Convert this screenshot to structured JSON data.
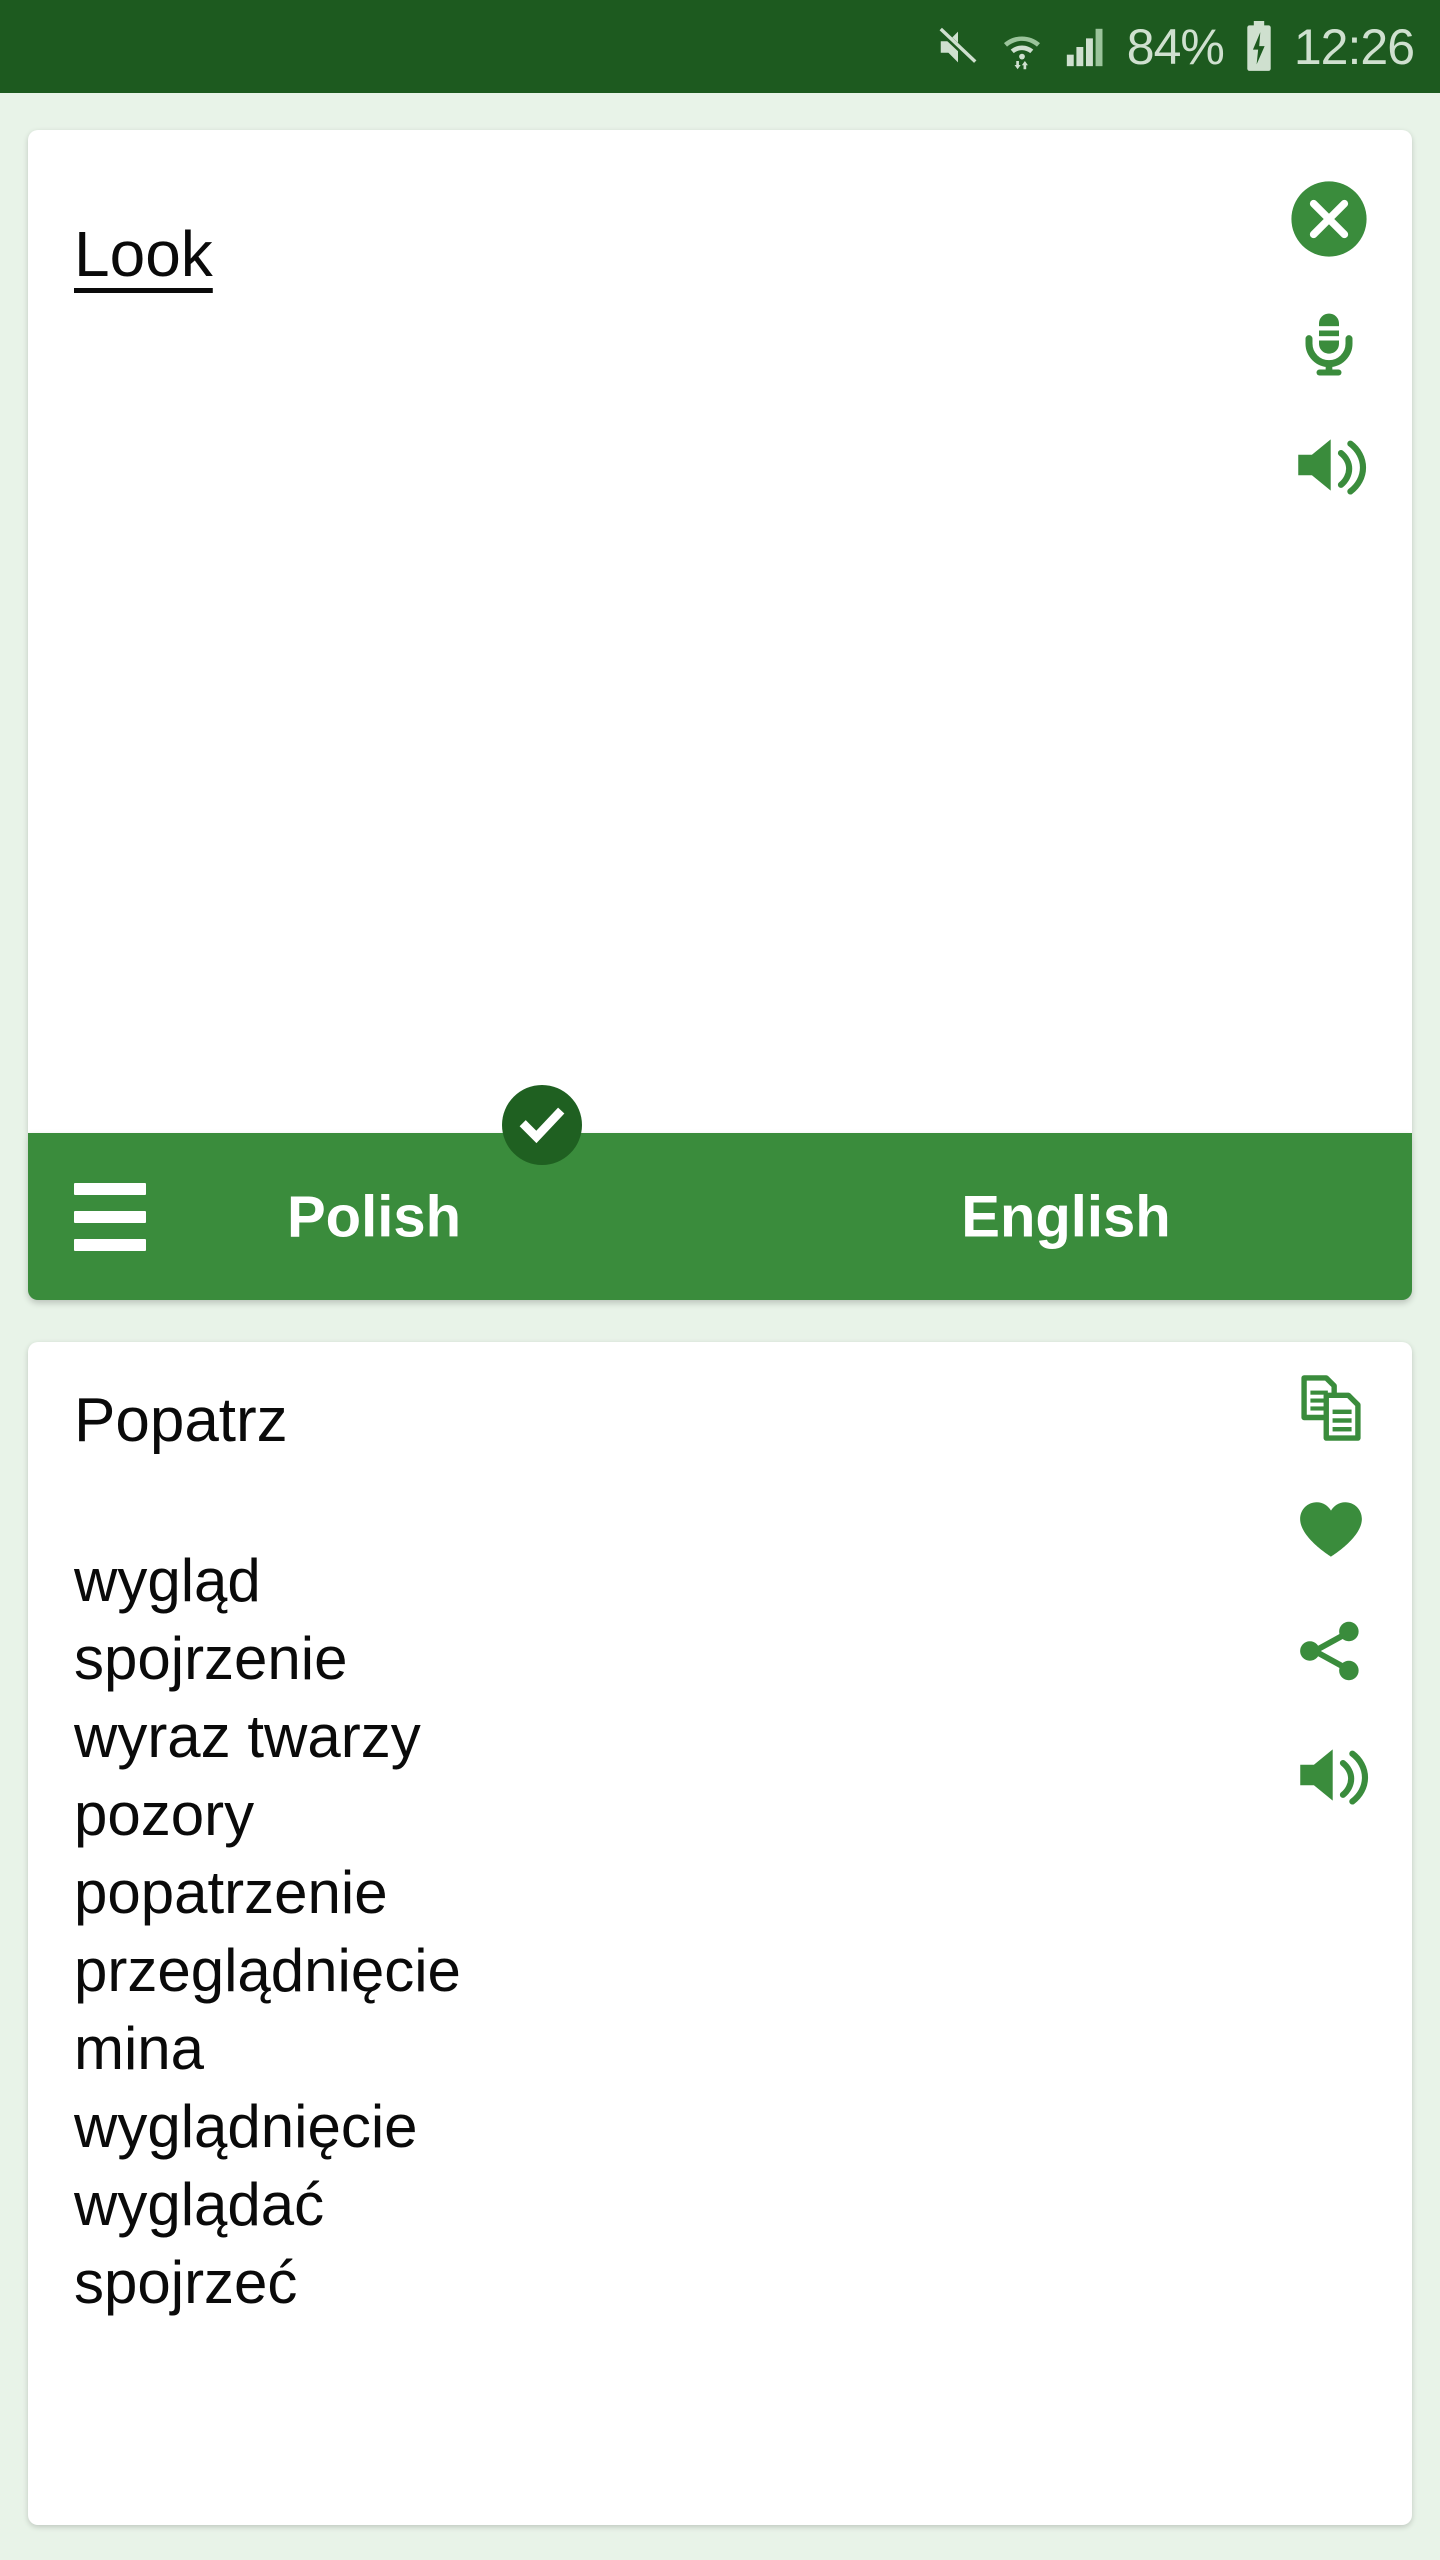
{
  "statusbar": {
    "battery_percent": "84%",
    "time": "12:26",
    "icons": [
      "volume-muted-icon",
      "wifi-icon",
      "signal-icon",
      "battery-charging-icon"
    ],
    "background_color": "#1d5a1f",
    "foreground_color": "#cfe0cf"
  },
  "input_card": {
    "text": "Look",
    "actions": [
      {
        "name": "clear-button",
        "icon": "close-circle-icon"
      },
      {
        "name": "voice-input-button",
        "icon": "microphone-icon"
      },
      {
        "name": "speak-source-button",
        "icon": "speaker-icon"
      }
    ]
  },
  "language_bar": {
    "menu_label": "menu",
    "source_language": "Polish",
    "target_language": "English",
    "selected_indicator": "check-icon",
    "background_color": "#3a8c3c",
    "badge_color": "#1f6021"
  },
  "result_card": {
    "primary_translation": "Popatrz",
    "translations": [
      "wygląd",
      "spojrzenie",
      "wyraz twarzy",
      "pozory",
      "popatrzenie",
      "przeglądnięcie",
      "mina",
      "wyglądnięcie",
      "wyglądać",
      "spojrzeć"
    ],
    "actions": [
      {
        "name": "copy-button",
        "icon": "copy-icon"
      },
      {
        "name": "favorite-button",
        "icon": "heart-icon"
      },
      {
        "name": "share-button",
        "icon": "share-icon"
      },
      {
        "name": "speak-result-button",
        "icon": "speaker-icon"
      }
    ]
  },
  "theme": {
    "page_background": "#e8f3e8",
    "accent_green": "#3a8c3c",
    "dark_green": "#1d5a1f"
  }
}
